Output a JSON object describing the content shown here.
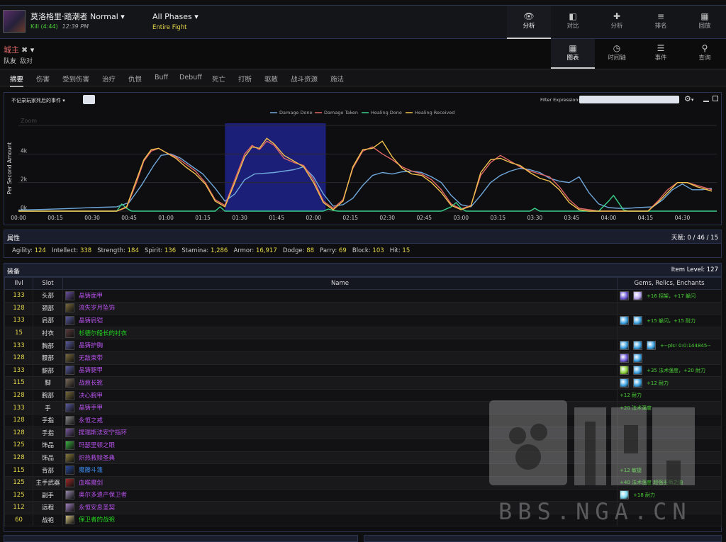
{
  "header": {
    "report_name": "莫洛格里·踏潮者 Normal",
    "result": "Kill (4:44)",
    "time": "12:39 PM",
    "phase": "All Phases",
    "phase_sub": "Entire Fight",
    "nav": [
      {
        "label": "分析",
        "icon": "eye-icon",
        "active": true
      },
      {
        "label": "对比",
        "icon": "compare-icon",
        "active": false
      },
      {
        "label": "分析",
        "icon": "puzzle-icon",
        "active": false
      },
      {
        "label": "排名",
        "icon": "ranking-icon",
        "active": false
      },
      {
        "label": "回放",
        "icon": "replay-icon",
        "active": false
      }
    ]
  },
  "target": {
    "name": "城主",
    "friendly": "队友",
    "enemy": "敌对",
    "views": [
      {
        "label": "图表",
        "icon": "grid-icon",
        "active": true
      },
      {
        "label": "时间轴",
        "icon": "clock-icon",
        "active": false
      },
      {
        "label": "事件",
        "icon": "list-icon",
        "active": false
      },
      {
        "label": "查询",
        "icon": "pin-icon",
        "active": false
      }
    ]
  },
  "tabs": [
    "摘要",
    "伤害",
    "受到伤害",
    "治疗",
    "仇恨",
    "Buff",
    "Debuff",
    "死亡",
    "打断",
    "驱散",
    "战斗资源",
    "施法"
  ],
  "chart_toolbar": {
    "dropdown": "不记录玩家死后的事件",
    "filter_label": "Filter Expression:"
  },
  "chart_data": {
    "type": "line",
    "ylabel": "Per Second Amount",
    "zoom_hint": "Zoom",
    "x_ticks": [
      "00:00",
      "00:15",
      "00:30",
      "00:45",
      "01:00",
      "01:15",
      "01:30",
      "01:45",
      "02:00",
      "02:15",
      "02:30",
      "02:45",
      "03:00",
      "03:15",
      "03:30",
      "03:45",
      "04:00",
      "04:15",
      "04:30"
    ],
    "y_ticks": [
      "0k",
      "2k",
      "4k"
    ],
    "ylim": [
      0,
      6000
    ],
    "xlim": [
      0,
      284
    ],
    "highlight_range": [
      84,
      125
    ],
    "legend_position": "top-center",
    "series": [
      {
        "name": "Damage Done",
        "color": "#6fa8dc",
        "points": [
          [
            0,
            80
          ],
          [
            10,
            120
          ],
          [
            20,
            180
          ],
          [
            30,
            250
          ],
          [
            40,
            300
          ],
          [
            45,
            600
          ],
          [
            50,
            1800
          ],
          [
            55,
            3200
          ],
          [
            58,
            3900
          ],
          [
            62,
            4000
          ],
          [
            66,
            3700
          ],
          [
            70,
            3200
          ],
          [
            75,
            2600
          ],
          [
            80,
            1600
          ],
          [
            84,
            700
          ],
          [
            88,
            1200
          ],
          [
            92,
            2200
          ],
          [
            96,
            2600
          ],
          [
            100,
            2650
          ],
          [
            104,
            2700
          ],
          [
            108,
            2800
          ],
          [
            112,
            2900
          ],
          [
            116,
            3100
          ],
          [
            120,
            2400
          ],
          [
            124,
            1200
          ],
          [
            128,
            350
          ],
          [
            132,
            450
          ],
          [
            136,
            900
          ],
          [
            140,
            1800
          ],
          [
            144,
            2500
          ],
          [
            148,
            2700
          ],
          [
            152,
            2600
          ],
          [
            156,
            2750
          ],
          [
            160,
            2800
          ],
          [
            164,
            2700
          ],
          [
            168,
            2400
          ],
          [
            172,
            2000
          ],
          [
            176,
            1100
          ],
          [
            180,
            450
          ],
          [
            184,
            300
          ],
          [
            188,
            1100
          ],
          [
            192,
            2000
          ],
          [
            196,
            2500
          ],
          [
            200,
            2800
          ],
          [
            204,
            3000
          ],
          [
            208,
            2900
          ],
          [
            212,
            2700
          ],
          [
            216,
            2300
          ],
          [
            220,
            2100
          ],
          [
            224,
            2000
          ],
          [
            228,
            2400
          ],
          [
            232,
            1300
          ],
          [
            236,
            500
          ],
          [
            240,
            250
          ],
          [
            244,
            200
          ],
          [
            248,
            200
          ],
          [
            252,
            250
          ],
          [
            258,
            300
          ],
          [
            262,
            800
          ],
          [
            266,
            1500
          ],
          [
            270,
            1900
          ],
          [
            274,
            1500
          ],
          [
            278,
            1500
          ],
          [
            282,
            1600
          ]
        ]
      },
      {
        "name": "Damage Taken",
        "color": "#e06666",
        "points": [
          [
            0,
            0
          ],
          [
            40,
            0
          ],
          [
            44,
            250
          ],
          [
            48,
            2000
          ],
          [
            51,
            3500
          ],
          [
            54,
            4200
          ],
          [
            57,
            4400
          ],
          [
            60,
            4100
          ],
          [
            64,
            3800
          ],
          [
            68,
            3300
          ],
          [
            72,
            2800
          ],
          [
            76,
            2000
          ],
          [
            80,
            800
          ],
          [
            84,
            400
          ],
          [
            88,
            2200
          ],
          [
            92,
            4000
          ],
          [
            95,
            4600
          ],
          [
            98,
            4300
          ],
          [
            101,
            4900
          ],
          [
            104,
            4600
          ],
          [
            108,
            3700
          ],
          [
            112,
            3400
          ],
          [
            116,
            3200
          ],
          [
            120,
            2200
          ],
          [
            124,
            700
          ],
          [
            128,
            200
          ],
          [
            132,
            800
          ],
          [
            136,
            3000
          ],
          [
            140,
            4200
          ],
          [
            144,
            4500
          ],
          [
            148,
            4000
          ],
          [
            152,
            3600
          ],
          [
            156,
            3100
          ],
          [
            160,
            2800
          ],
          [
            164,
            2600
          ],
          [
            168,
            2200
          ],
          [
            172,
            1500
          ],
          [
            176,
            500
          ],
          [
            180,
            150
          ],
          [
            184,
            400
          ],
          [
            188,
            2500
          ],
          [
            192,
            3400
          ],
          [
            196,
            3900
          ],
          [
            200,
            3500
          ],
          [
            204,
            3100
          ],
          [
            208,
            2800
          ],
          [
            212,
            2600
          ],
          [
            216,
            2400
          ],
          [
            220,
            1700
          ],
          [
            224,
            800
          ],
          [
            228,
            200
          ],
          [
            232,
            100
          ],
          [
            236,
            0
          ],
          [
            256,
            0
          ],
          [
            260,
            700
          ],
          [
            264,
            1500
          ],
          [
            268,
            2000
          ],
          [
            272,
            2000
          ],
          [
            276,
            1800
          ],
          [
            282,
            1500
          ]
        ]
      },
      {
        "name": "Healing Done",
        "color": "#3ad18c",
        "points": [
          [
            0,
            0
          ],
          [
            40,
            0
          ],
          [
            42,
            500
          ],
          [
            44,
            200
          ],
          [
            46,
            0
          ],
          [
            80,
            0
          ],
          [
            82,
            300
          ],
          [
            84,
            0
          ],
          [
            124,
            0
          ],
          [
            126,
            150
          ],
          [
            128,
            50
          ],
          [
            130,
            0
          ],
          [
            172,
            0
          ],
          [
            176,
            300
          ],
          [
            178,
            600
          ],
          [
            180,
            200
          ],
          [
            182,
            0
          ],
          [
            208,
            0
          ],
          [
            210,
            200
          ],
          [
            212,
            0
          ],
          [
            236,
            0
          ],
          [
            240,
            700
          ],
          [
            242,
            1100
          ],
          [
            244,
            600
          ],
          [
            246,
            100
          ],
          [
            248,
            0
          ],
          [
            284,
            0
          ]
        ]
      },
      {
        "name": "Healing Received",
        "color": "#f2c14e",
        "points": [
          [
            0,
            0
          ],
          [
            40,
            0
          ],
          [
            44,
            300
          ],
          [
            48,
            2200
          ],
          [
            51,
            3600
          ],
          [
            54,
            4300
          ],
          [
            57,
            4400
          ],
          [
            60,
            4100
          ],
          [
            64,
            3700
          ],
          [
            68,
            3100
          ],
          [
            72,
            2600
          ],
          [
            76,
            1900
          ],
          [
            80,
            700
          ],
          [
            84,
            300
          ],
          [
            88,
            2000
          ],
          [
            92,
            3800
          ],
          [
            95,
            4500
          ],
          [
            98,
            4400
          ],
          [
            101,
            5100
          ],
          [
            104,
            4700
          ],
          [
            108,
            3900
          ],
          [
            112,
            3500
          ],
          [
            116,
            3100
          ],
          [
            120,
            2000
          ],
          [
            124,
            600
          ],
          [
            128,
            100
          ],
          [
            132,
            700
          ],
          [
            136,
            3100
          ],
          [
            140,
            4300
          ],
          [
            144,
            4400
          ],
          [
            148,
            4900
          ],
          [
            152,
            3800
          ],
          [
            156,
            3000
          ],
          [
            160,
            2600
          ],
          [
            164,
            2500
          ],
          [
            168,
            2000
          ],
          [
            172,
            1300
          ],
          [
            176,
            400
          ],
          [
            180,
            100
          ],
          [
            184,
            350
          ],
          [
            188,
            2700
          ],
          [
            192,
            3600
          ],
          [
            196,
            3700
          ],
          [
            200,
            3400
          ],
          [
            204,
            3200
          ],
          [
            208,
            2700
          ],
          [
            212,
            2300
          ],
          [
            216,
            2100
          ],
          [
            220,
            1500
          ],
          [
            224,
            600
          ],
          [
            228,
            100
          ],
          [
            232,
            0
          ],
          [
            256,
            0
          ],
          [
            260,
            600
          ],
          [
            264,
            1300
          ],
          [
            268,
            2000
          ],
          [
            272,
            2000
          ],
          [
            276,
            1700
          ],
          [
            282,
            1400
          ]
        ]
      }
    ]
  },
  "attributes": {
    "title": "属性",
    "talent_label": "天赋:",
    "talent_value": "0 / 46 / 15",
    "stats": [
      {
        "label": "Agility:",
        "value": "124"
      },
      {
        "label": "Intellect:",
        "value": "338"
      },
      {
        "label": "Strength:",
        "value": "184"
      },
      {
        "label": "Spirit:",
        "value": "136"
      },
      {
        "label": "Stamina:",
        "value": "1,286"
      },
      {
        "label": "Armor:",
        "value": "16,917"
      },
      {
        "label": "Dodge:",
        "value": "88"
      },
      {
        "label": "Parry:",
        "value": "69"
      },
      {
        "label": "Block:",
        "value": "103"
      },
      {
        "label": "Hit:",
        "value": "15"
      }
    ]
  },
  "equipment": {
    "title": "装备",
    "item_level_label": "Item Level:",
    "item_level": "127",
    "columns": [
      "Ilvl",
      "Slot",
      "Name",
      "Gems, Relics, Enchants"
    ],
    "rows": [
      {
        "ilvl": "133",
        "slot": "头部",
        "name": "晶铸面甲",
        "quality": "epic",
        "icon": "#6a4fa0",
        "gems": [
          "#6f5ad8",
          "#b9a6f0"
        ],
        "enchant": "+16 招架，+17 躲闪"
      },
      {
        "ilvl": "128",
        "slot": "颈部",
        "name": "流失岁月坠饰",
        "quality": "epic",
        "icon": "#7a6a3a",
        "gems": [],
        "enchant": ""
      },
      {
        "ilvl": "133",
        "slot": "肩部",
        "name": "晶铸肩铠",
        "quality": "epic",
        "icon": "#5a5aa0",
        "gems": [
          "#3aa0e0",
          "#3aa0e0"
        ],
        "enchant": "+15 躲闪，+15 耐力"
      },
      {
        "ilvl": "15",
        "slot": "衬衣",
        "name": "杉德尔船长的衬衣",
        "quality": "uncommon",
        "icon": "#5a3a3a",
        "gems": [],
        "enchant": ""
      },
      {
        "ilvl": "133",
        "slot": "胸部",
        "name": "晶铸护胸",
        "quality": "epic",
        "icon": "#5a5aa0",
        "gems": [
          "#3aa0e0",
          "#3aa0e0",
          "#3aa0e0"
        ],
        "enchant": "+<i>--pls! 0:0:144845--</i>"
      },
      {
        "ilvl": "128",
        "slot": "腰部",
        "name": "无敌束带",
        "quality": "epic",
        "icon": "#7a6a3a",
        "gems": [
          "#6f5ad8",
          "#3aa0e0"
        ],
        "enchant": ""
      },
      {
        "ilvl": "133",
        "slot": "腿部",
        "name": "晶铸腿甲",
        "quality": "epic",
        "icon": "#5a5aa0",
        "gems": [
          "#8ad03a",
          "#3aa0e0"
        ],
        "enchant": "+35 法术强度，+20 耐力"
      },
      {
        "ilvl": "115",
        "slot": "脚",
        "name": "战痕长靴",
        "quality": "epic",
        "icon": "#7a6a5a",
        "gems": [
          "#3aa0e0",
          "#3aa0e0"
        ],
        "enchant": "+12 耐力"
      },
      {
        "ilvl": "128",
        "slot": "腕部",
        "name": "决心腕甲",
        "quality": "epic",
        "icon": "#7a6a3a",
        "gems": [],
        "enchant": "+12 耐力"
      },
      {
        "ilvl": "133",
        "slot": "手",
        "name": "晶铸手甲",
        "quality": "epic",
        "icon": "#5a5aa0",
        "gems": [],
        "enchant": "+20 法术强度"
      },
      {
        "ilvl": "128",
        "slot": "手指",
        "name": "永恒之戒",
        "quality": "epic",
        "icon": "#8a8a8a",
        "gems": [],
        "enchant": ""
      },
      {
        "ilvl": "128",
        "slot": "手指",
        "name": "提瑞斯法安宁指环",
        "quality": "epic",
        "icon": "#7a5aa0",
        "gems": [],
        "enchant": ""
      },
      {
        "ilvl": "125",
        "slot": "饰品",
        "name": "玛瑟里顿之眼",
        "quality": "epic",
        "icon": "#3ab040",
        "gems": [],
        "enchant": ""
      },
      {
        "ilvl": "128",
        "slot": "饰品",
        "name": "炽热救赎圣典",
        "quality": "epic",
        "icon": "#8a7a3a",
        "gems": [],
        "enchant": ""
      },
      {
        "ilvl": "115",
        "slot": "背部",
        "name": "魔藤斗篷",
        "quality": "rare",
        "icon": "#2a4a9a",
        "gems": [],
        "enchant": "+12 敏捷"
      },
      {
        "ilvl": "125",
        "slot": "主手武器",
        "name": "血喉魔剑",
        "quality": "epic",
        "icon": "#a02a2a",
        "gems": [],
        "enchant": "+40 法术强度 超强巫师之油"
      },
      {
        "ilvl": "125",
        "slot": "副手",
        "name": "奥尔多遗产保卫者",
        "quality": "epic",
        "icon": "#9a8ab0",
        "gems": [
          "#7adaf0"
        ],
        "enchant": "+18 耐力"
      },
      {
        "ilvl": "112",
        "slot": "远程",
        "name": "永恒安息圣契",
        "quality": "epic",
        "icon": "#a080c0",
        "gems": [],
        "enchant": ""
      },
      {
        "ilvl": "60",
        "slot": "战袍",
        "name": "保卫者的战袍",
        "quality": "uncommon",
        "icon": "#d0c080",
        "gems": [],
        "enchant": ""
      }
    ]
  },
  "watermark": {
    "text": "BBS.NGA.CN",
    "logo": "NGA"
  }
}
